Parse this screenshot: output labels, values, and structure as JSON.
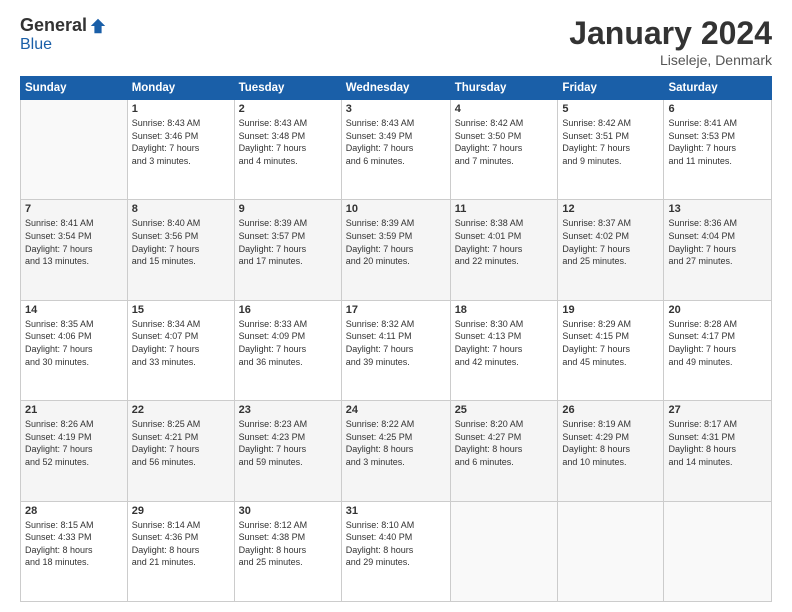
{
  "header": {
    "logo_general": "General",
    "logo_blue": "Blue",
    "month_title": "January 2024",
    "location": "Liseleje, Denmark"
  },
  "days_of_week": [
    "Sunday",
    "Monday",
    "Tuesday",
    "Wednesday",
    "Thursday",
    "Friday",
    "Saturday"
  ],
  "weeks": [
    [
      {
        "day": "",
        "info": ""
      },
      {
        "day": "1",
        "info": "Sunrise: 8:43 AM\nSunset: 3:46 PM\nDaylight: 7 hours\nand 3 minutes."
      },
      {
        "day": "2",
        "info": "Sunrise: 8:43 AM\nSunset: 3:48 PM\nDaylight: 7 hours\nand 4 minutes."
      },
      {
        "day": "3",
        "info": "Sunrise: 8:43 AM\nSunset: 3:49 PM\nDaylight: 7 hours\nand 6 minutes."
      },
      {
        "day": "4",
        "info": "Sunrise: 8:42 AM\nSunset: 3:50 PM\nDaylight: 7 hours\nand 7 minutes."
      },
      {
        "day": "5",
        "info": "Sunrise: 8:42 AM\nSunset: 3:51 PM\nDaylight: 7 hours\nand 9 minutes."
      },
      {
        "day": "6",
        "info": "Sunrise: 8:41 AM\nSunset: 3:53 PM\nDaylight: 7 hours\nand 11 minutes."
      }
    ],
    [
      {
        "day": "7",
        "info": "Sunrise: 8:41 AM\nSunset: 3:54 PM\nDaylight: 7 hours\nand 13 minutes."
      },
      {
        "day": "8",
        "info": "Sunrise: 8:40 AM\nSunset: 3:56 PM\nDaylight: 7 hours\nand 15 minutes."
      },
      {
        "day": "9",
        "info": "Sunrise: 8:39 AM\nSunset: 3:57 PM\nDaylight: 7 hours\nand 17 minutes."
      },
      {
        "day": "10",
        "info": "Sunrise: 8:39 AM\nSunset: 3:59 PM\nDaylight: 7 hours\nand 20 minutes."
      },
      {
        "day": "11",
        "info": "Sunrise: 8:38 AM\nSunset: 4:01 PM\nDaylight: 7 hours\nand 22 minutes."
      },
      {
        "day": "12",
        "info": "Sunrise: 8:37 AM\nSunset: 4:02 PM\nDaylight: 7 hours\nand 25 minutes."
      },
      {
        "day": "13",
        "info": "Sunrise: 8:36 AM\nSunset: 4:04 PM\nDaylight: 7 hours\nand 27 minutes."
      }
    ],
    [
      {
        "day": "14",
        "info": "Sunrise: 8:35 AM\nSunset: 4:06 PM\nDaylight: 7 hours\nand 30 minutes."
      },
      {
        "day": "15",
        "info": "Sunrise: 8:34 AM\nSunset: 4:07 PM\nDaylight: 7 hours\nand 33 minutes."
      },
      {
        "day": "16",
        "info": "Sunrise: 8:33 AM\nSunset: 4:09 PM\nDaylight: 7 hours\nand 36 minutes."
      },
      {
        "day": "17",
        "info": "Sunrise: 8:32 AM\nSunset: 4:11 PM\nDaylight: 7 hours\nand 39 minutes."
      },
      {
        "day": "18",
        "info": "Sunrise: 8:30 AM\nSunset: 4:13 PM\nDaylight: 7 hours\nand 42 minutes."
      },
      {
        "day": "19",
        "info": "Sunrise: 8:29 AM\nSunset: 4:15 PM\nDaylight: 7 hours\nand 45 minutes."
      },
      {
        "day": "20",
        "info": "Sunrise: 8:28 AM\nSunset: 4:17 PM\nDaylight: 7 hours\nand 49 minutes."
      }
    ],
    [
      {
        "day": "21",
        "info": "Sunrise: 8:26 AM\nSunset: 4:19 PM\nDaylight: 7 hours\nand 52 minutes."
      },
      {
        "day": "22",
        "info": "Sunrise: 8:25 AM\nSunset: 4:21 PM\nDaylight: 7 hours\nand 56 minutes."
      },
      {
        "day": "23",
        "info": "Sunrise: 8:23 AM\nSunset: 4:23 PM\nDaylight: 7 hours\nand 59 minutes."
      },
      {
        "day": "24",
        "info": "Sunrise: 8:22 AM\nSunset: 4:25 PM\nDaylight: 8 hours\nand 3 minutes."
      },
      {
        "day": "25",
        "info": "Sunrise: 8:20 AM\nSunset: 4:27 PM\nDaylight: 8 hours\nand 6 minutes."
      },
      {
        "day": "26",
        "info": "Sunrise: 8:19 AM\nSunset: 4:29 PM\nDaylight: 8 hours\nand 10 minutes."
      },
      {
        "day": "27",
        "info": "Sunrise: 8:17 AM\nSunset: 4:31 PM\nDaylight: 8 hours\nand 14 minutes."
      }
    ],
    [
      {
        "day": "28",
        "info": "Sunrise: 8:15 AM\nSunset: 4:33 PM\nDaylight: 8 hours\nand 18 minutes."
      },
      {
        "day": "29",
        "info": "Sunrise: 8:14 AM\nSunset: 4:36 PM\nDaylight: 8 hours\nand 21 minutes."
      },
      {
        "day": "30",
        "info": "Sunrise: 8:12 AM\nSunset: 4:38 PM\nDaylight: 8 hours\nand 25 minutes."
      },
      {
        "day": "31",
        "info": "Sunrise: 8:10 AM\nSunset: 4:40 PM\nDaylight: 8 hours\nand 29 minutes."
      },
      {
        "day": "",
        "info": ""
      },
      {
        "day": "",
        "info": ""
      },
      {
        "day": "",
        "info": ""
      }
    ]
  ]
}
